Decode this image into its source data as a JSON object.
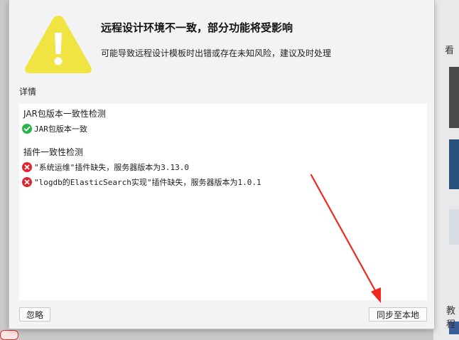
{
  "dialog": {
    "title": "远程设计环境不一致，部分功能将受影响",
    "subtitle": "可能导致远程设计模板时出错或存在未知风险，建议及时处理",
    "details_label": "详情",
    "warning_icon": "warning-triangle-icon",
    "accent_warning_color": "#f0e442"
  },
  "details": {
    "sections": [
      {
        "title": "JAR包版本一致性检测",
        "items": [
          {
            "status": "ok",
            "icon": "check-circle-icon",
            "text": "JAR包版本一致"
          }
        ]
      },
      {
        "title": "插件一致性检测",
        "items": [
          {
            "status": "error",
            "icon": "error-circle-icon",
            "text": "\"系统运维\"插件缺失，服务器版本为3.13.0"
          },
          {
            "status": "error",
            "icon": "error-circle-icon",
            "text": "\"logdb的ElasticSearch实现\"插件缺失，服务器版本为1.0.1"
          }
        ]
      }
    ],
    "status_colors": {
      "ok": "#2cb34a",
      "error": "#e0242f"
    }
  },
  "buttons": {
    "ignore": "忽略",
    "sync": "同步至本地"
  },
  "background": {
    "right_text_1": "看",
    "right_text_2": "教程"
  }
}
